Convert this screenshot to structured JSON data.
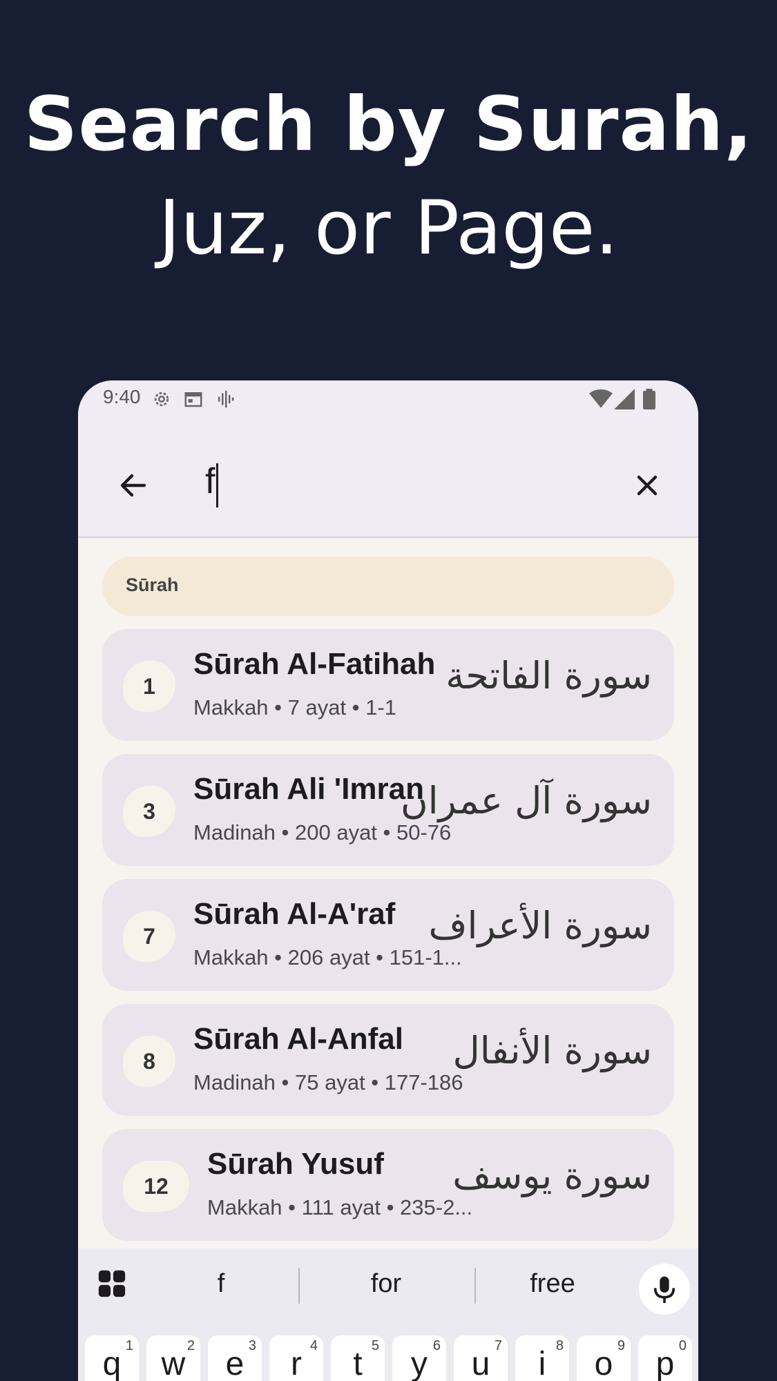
{
  "headline": {
    "line1": "Search by Surah,",
    "line2": "Juz, or Page."
  },
  "status_bar": {
    "time": "9:40"
  },
  "search": {
    "query": "f"
  },
  "section_label": "Sūrah",
  "results": [
    {
      "number": "1",
      "title": "Sūrah Al-Fatihah",
      "subtitle": "Makkah • 7 ayat • 1-1",
      "arabic": "سورة الفاتحة"
    },
    {
      "number": "3",
      "title": "Sūrah Ali 'Imran",
      "subtitle": "Madinah • 200 ayat • 50-76",
      "arabic": "سورة آل عمران"
    },
    {
      "number": "7",
      "title": "Sūrah Al-A'raf",
      "subtitle": "Makkah • 206 ayat • 151-1...",
      "arabic": "سورة الأعراف"
    },
    {
      "number": "8",
      "title": "Sūrah Al-Anfal",
      "subtitle": "Madinah • 75 ayat • 177-186",
      "arabic": "سورة الأنفال"
    },
    {
      "number": "12",
      "title": "Sūrah Yusuf",
      "subtitle": "Makkah • 111 ayat • 235-2...",
      "arabic": "سورة يوسف"
    }
  ],
  "keyboard": {
    "suggestions": [
      "f",
      "for",
      "free"
    ],
    "keys": [
      {
        "ch": "q",
        "sup": "1"
      },
      {
        "ch": "w",
        "sup": "2"
      },
      {
        "ch": "e",
        "sup": "3"
      },
      {
        "ch": "r",
        "sup": "4"
      },
      {
        "ch": "t",
        "sup": "5"
      },
      {
        "ch": "y",
        "sup": "6"
      },
      {
        "ch": "u",
        "sup": "7"
      },
      {
        "ch": "i",
        "sup": "8"
      },
      {
        "ch": "o",
        "sup": "9"
      },
      {
        "ch": "p",
        "sup": "0"
      }
    ]
  }
}
